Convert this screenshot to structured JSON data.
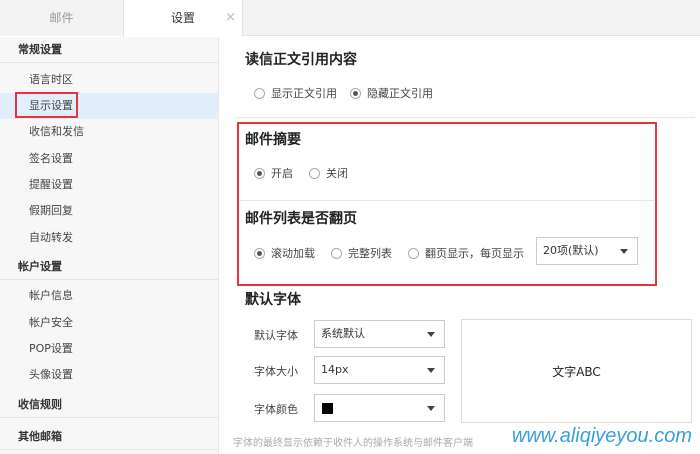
{
  "tabs": {
    "mail": "邮件",
    "settings": "设置",
    "close": "×"
  },
  "sidebar": {
    "general": "常规设置",
    "general_items": [
      "语言时区",
      "显示设置",
      "收信和发信",
      "签名设置",
      "提醒设置",
      "假期回复",
      "自动转发"
    ],
    "account": "帐户设置",
    "account_items": [
      "帐户信息",
      "帐户安全",
      "POP设置",
      "头像设置"
    ],
    "rules": "收信规则",
    "other": "其他邮箱"
  },
  "quote": {
    "heading": "读信正文引用内容",
    "options": [
      "显示正文引用",
      "隐藏正文引用"
    ],
    "selected": 1
  },
  "digest": {
    "heading": "邮件摘要",
    "options": [
      "开启",
      "关闭"
    ],
    "selected": 0
  },
  "paging": {
    "heading": "邮件列表是否翻页",
    "options": [
      "滚动加载",
      "完整列表",
      "翻页显示，每页显示"
    ],
    "selected": 0,
    "per_page": "20项(默认)"
  },
  "font": {
    "heading": "默认字体",
    "family_label": "默认字体",
    "family_value": "系统默认",
    "size_label": "字体大小",
    "size_value": "14px",
    "color_label": "字体颜色",
    "color_value": "#000000",
    "preview_text": "文字ABC",
    "note": "字体的最终显示依赖于收件人的操作系统与邮件客户端"
  },
  "watermark": "www.aliqiyeyou.com",
  "colors": {
    "accent_red": "#e3373b",
    "active_bg": "#e2eefb",
    "watermark": "#1a8cd8"
  }
}
